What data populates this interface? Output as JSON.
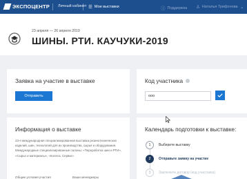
{
  "topbar": {
    "logo": "ЭКСПОЦЕНТР",
    "cabinet": "Личный кабинет",
    "my_exhibitions": "Мои выставки",
    "support": "Поддержка",
    "user": "Наталья Трифонова"
  },
  "event": {
    "dates": "23 апреля — 26 апреля 2019",
    "title": "ШИНЫ. РТИ. КАУЧУКИ-2019"
  },
  "apply_card": {
    "title": "Заявка на участие в выставке",
    "button": "Отправить"
  },
  "code_card": {
    "title": "Код участника",
    "input_value": "ооо"
  },
  "info_card": {
    "title": "Информация о выставке",
    "description": "23-я международная специализированная выставка резинотехнических изделий, шин, технологий для их производства, сырья и оборудования. Международные специализированные салоны: «Переработка шин и РТИ», «Сырье и материалы», «Колеса. Сервис»",
    "col_left": "Общие условия участия",
    "col_right": "Ваши менеджеры"
  },
  "calendar_card": {
    "title": "Календарь подготовки к выставке:",
    "steps": [
      {
        "num": "1",
        "label": "Выберите выставку"
      },
      {
        "num": "2",
        "label": "Отправьте заявку на участие"
      },
      {
        "num": "3",
        "label": "Заключите договор (код участника)"
      }
    ]
  },
  "colors": {
    "topbar": "#1d4f8e",
    "primary": "#1b77d2",
    "background": "#eef0f3",
    "step_active": "#1f3a5c"
  },
  "icons": [
    "logo-mark-icon",
    "list-icon",
    "help-icon",
    "user-icon",
    "chevron-down-icon",
    "event-icon",
    "check-icon",
    "cursor-icon"
  ]
}
